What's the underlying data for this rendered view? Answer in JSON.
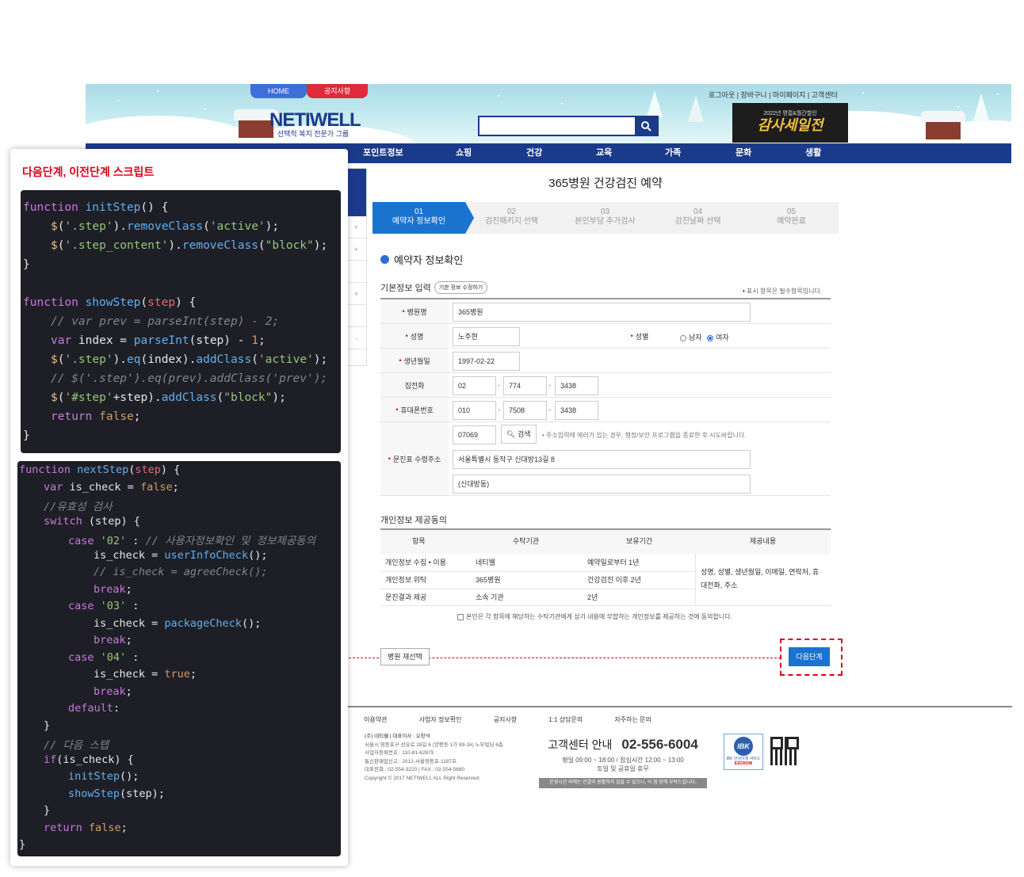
{
  "header": {
    "tab_home": "HOME",
    "tab_notice": "공지사항",
    "logo_main": "NETIWELL",
    "logo_sub": "선택적 복지 전문가 그룹",
    "search_icon": "search-icon",
    "top_links": "로그아웃 | 장바구니 | 마이페이지 | 고객센터",
    "banner_small": "2022년 명절&월간할인",
    "banner_big": "감사세일전",
    "nav": [
      "포인트정보",
      "쇼핑",
      "건강",
      "교육",
      "가족",
      "문화",
      "생활"
    ]
  },
  "sidebar": [
    "+",
    "+",
    "+",
    "-"
  ],
  "page": {
    "title": "365병원 건강검진 예약",
    "steps": [
      {
        "num": "01",
        "label": "예약자 정보확인"
      },
      {
        "num": "02",
        "label": "검진패키지 선택"
      },
      {
        "num": "03",
        "label": "본인부담 추가검사"
      },
      {
        "num": "04",
        "label": "검진날짜 선택"
      },
      {
        "num": "05",
        "label": "예약완료"
      }
    ],
    "section_title": "예약자 정보확인",
    "basic_info": "기본정보 입력",
    "edit_pill": "기본 정보 수정하기",
    "required_note": "표시 항목은 필수항목입니다.",
    "form": {
      "hospital_label": "병원명",
      "hospital_value": "365병원",
      "name_label": "성명",
      "name_value": "노주현",
      "gender_label": "성별",
      "male": "남자",
      "female": "여자",
      "birth_label": "생년월일",
      "birth_value": "1997-02-22",
      "home_label": "집전화",
      "home1": "02",
      "home2": "774",
      "home3": "3438",
      "mobile_label": "휴대폰번호",
      "mob1": "010",
      "mob2": "7508",
      "mob3": "3438",
      "addr_label": "문진표 수령주소",
      "zip": "07069",
      "search_btn": "검색",
      "addr_note": "• 주소입력에 에러가 있는 경우, 행정/보안 프로그램을 종료한 후 시도바랍니다.",
      "addr1": "서울특별시 동작구 신대방13길 8",
      "addr2": "(신대방동)"
    },
    "privacy": {
      "title": "개인정보 제공동의",
      "headers": [
        "항목",
        "수탁기관",
        "보유기간",
        "제공내용"
      ],
      "rows": [
        [
          "개인정보 수집 • 이용",
          "네티웰",
          "예약일로부터 1년"
        ],
        [
          "개인정보 위탁",
          "365병원",
          "건강검진 이후 2년"
        ],
        [
          "문진결과 제공",
          "소속 기관",
          "2년"
        ]
      ],
      "content_line1": "성명, 성별, 생년월일, 이메일, 연락처, 휴",
      "content_line2": "대전화, 주소",
      "agree": "본인은 각 항목에 해당하는 수탁기관에게 상기 내용에 부합하는 개인정보를 제공하는 것에 동의합니다."
    },
    "prev_button": "병원 재선택",
    "next_button": "다음단계"
  },
  "footer": {
    "links": [
      "이용약관",
      "사업자 정보확인",
      "공지사항",
      "1:1 상담문의",
      "자주하는 문의"
    ],
    "info": [
      "(주) 네티웰 | 대표이사 : 오창석",
      "서울시 영등포구 선유로 28길 6 (양평동 1가 89-16) 노무빌딩 6층",
      "사업자등록번호 : 110-81-62879",
      "통신판매업신고 : 2012-서울영등포-1187호",
      "대표전화 : 02-554-3220 | FAX : 02-554-5680",
      "Copyright © 2017 NETIWELL ALL Right Reserved."
    ],
    "cs_title": "고객센터 안내",
    "cs_phone": "02-556-6004",
    "cs_hours": "평일 09:00 ~ 18:00 / 점심시간 12:00 ~ 13:00",
    "cs_off": "토일 및 공휴일 휴무",
    "cs_bar": "운영시간 외에는 연결이 원활하지 않을 수 있으니, 이 점 양해 부탁드립니다.",
    "ibk_label": "IBK 안심이체 서비스",
    "ibk_escrow": "ESCROW"
  },
  "panel": {
    "title": "다음단계, 이전단계 스크립트"
  },
  "colors": {
    "nav": "#1b3a8a",
    "step_active": "#1b73d0",
    "annotation": "#d8001b",
    "code_bg": "#1e1f26"
  }
}
